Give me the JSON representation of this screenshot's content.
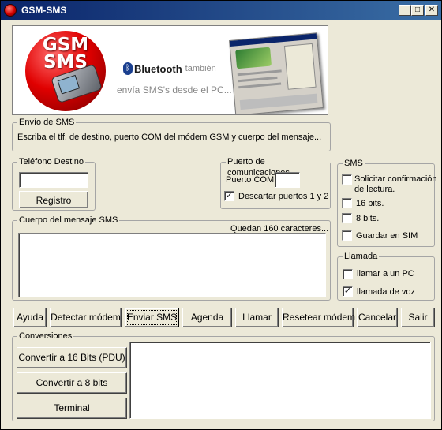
{
  "window": {
    "title": "GSM-SMS",
    "min_glyph": "_",
    "max_glyph": "□",
    "close_glyph": "✕"
  },
  "banner": {
    "logo_line1": "GSM",
    "logo_line2": "SMS",
    "bluetooth_glyph": "ᛒ",
    "bluetooth_word": "Bluetooth",
    "bluetooth_extra": "también",
    "tagline": "envía SMS's desde el PC..."
  },
  "envio": {
    "legend": "Envío de SMS",
    "description": "Escriba el tlf. de destino, puerto COM del módem GSM y cuerpo del mensaje..."
  },
  "telefono": {
    "legend": "Teléfono Destino",
    "value": "",
    "registro_label": "Registro"
  },
  "puerto": {
    "legend": "Puerto de comunicaciones",
    "com_label": "Puerto COM:",
    "com_value": "",
    "descartar_label": "Descartar puertos 1 y 2",
    "descartar_checked": true
  },
  "sms": {
    "legend": "SMS",
    "options": [
      {
        "label": "Solicitar confirmación",
        "label2": "de lectura.",
        "checked": false
      },
      {
        "label": "16 bits.",
        "checked": false
      },
      {
        "label": "8 bits.",
        "checked": false
      },
      {
        "label": "Guardar en SIM",
        "checked": false
      }
    ]
  },
  "cuerpo": {
    "legend": "Cuerpo del mensaje SMS",
    "remaining": "Quedan 160 caracteres...",
    "text": ""
  },
  "llamada": {
    "legend": "Llamada",
    "options": [
      {
        "label": "llamar a un PC",
        "checked": false
      },
      {
        "label": "llamada de voz",
        "checked": true
      }
    ]
  },
  "toolbar": {
    "ayuda": "Ayuda",
    "detectar": "Detectar módem",
    "enviar": "Enviar SMS",
    "agenda": "Agenda",
    "llamar": "Llamar",
    "resetear": "Resetear módem",
    "cancelar": "Cancelar",
    "salir": "Salir"
  },
  "conversiones": {
    "legend": "Conversiones",
    "btn_16": "Convertir a 16 Bits (PDU)",
    "btn_8": "Convertir a 8 bits",
    "btn_terminal": "Terminal",
    "output": ""
  },
  "check_glyph": "✓"
}
